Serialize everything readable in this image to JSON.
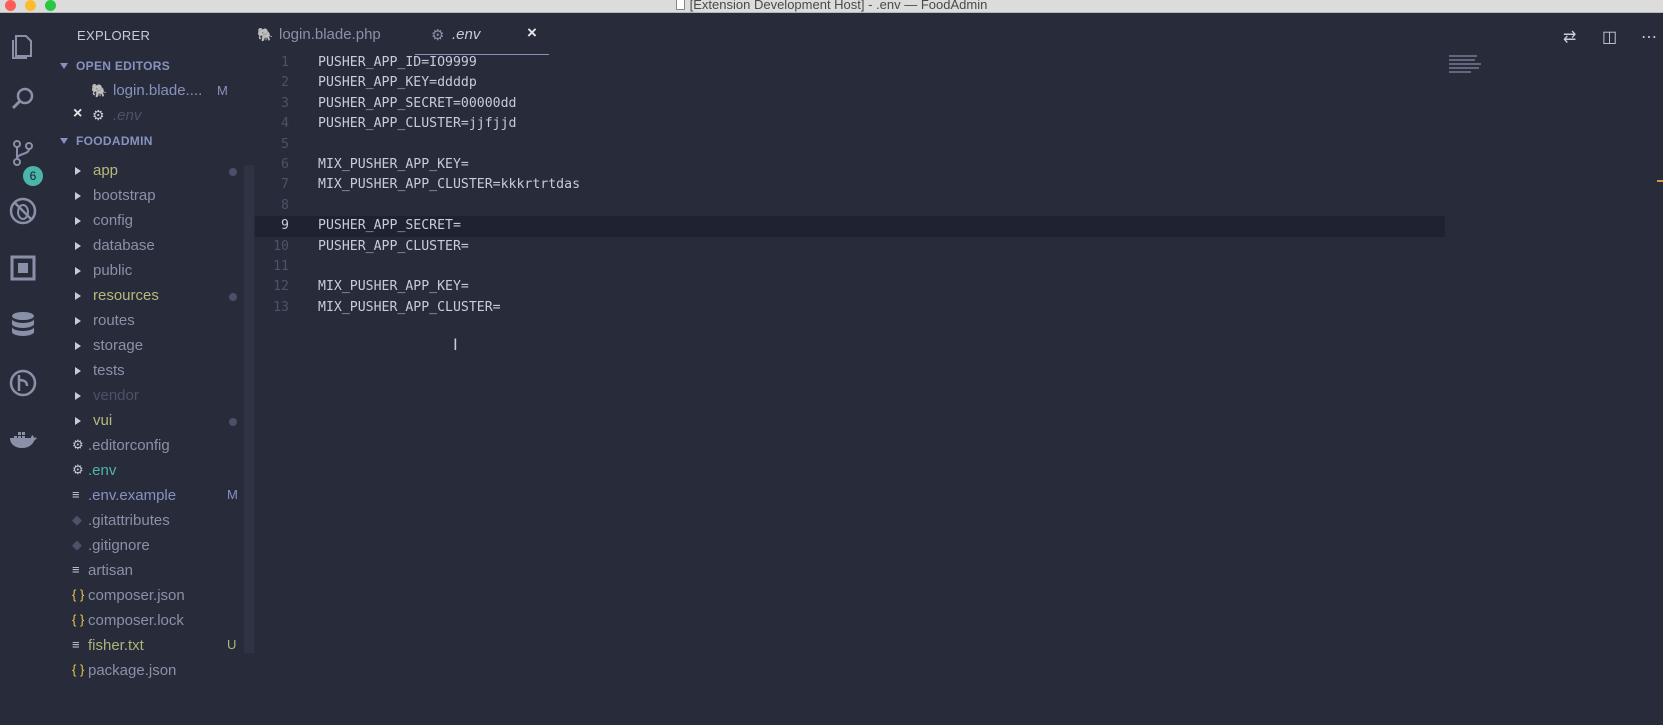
{
  "window": {
    "title": "[Extension Development Host] - .env — FoodAdmin"
  },
  "activity_bar": {
    "items": [
      "files-icon",
      "search-icon",
      "source-control-icon",
      "debug-icon",
      "extensions-icon",
      "database-icon",
      "git-graph-icon",
      "docker-icon"
    ],
    "source_control_badge": "6"
  },
  "sidebar": {
    "title": "EXPLORER",
    "open_editors_header": "OPEN EDITORS",
    "open_editors": [
      {
        "label": "login.blade....",
        "status": "M"
      },
      {
        "label": ".env"
      }
    ],
    "project_header": "FOODADMIN",
    "folders": [
      {
        "label": "app",
        "modified": true
      },
      {
        "label": "bootstrap",
        "modified": false
      },
      {
        "label": "config",
        "modified": false
      },
      {
        "label": "database",
        "modified": false
      },
      {
        "label": "public",
        "modified": false
      },
      {
        "label": "resources",
        "modified": true
      },
      {
        "label": "routes",
        "modified": false
      },
      {
        "label": "storage",
        "modified": false
      },
      {
        "label": "tests",
        "modified": false
      },
      {
        "label": "vendor",
        "modified": false
      },
      {
        "label": "vui",
        "modified": true
      }
    ],
    "files": [
      {
        "label": ".editorconfig",
        "icon": "gear-icon",
        "status": ""
      },
      {
        "label": ".env",
        "icon": "gear-icon",
        "status": ""
      },
      {
        "label": ".env.example",
        "icon": "lines-icon",
        "status": "M"
      },
      {
        "label": ".gitattributes",
        "icon": "git-icon",
        "status": ""
      },
      {
        "label": ".gitignore",
        "icon": "git-icon",
        "status": ""
      },
      {
        "label": "artisan",
        "icon": "lines-icon",
        "status": ""
      },
      {
        "label": "composer.json",
        "icon": "json-icon",
        "status": ""
      },
      {
        "label": "composer.lock",
        "icon": "json-icon",
        "status": ""
      },
      {
        "label": "fisher.txt",
        "icon": "lines-icon",
        "status": "U"
      },
      {
        "label": "package.json",
        "icon": "json-icon",
        "status": ""
      }
    ]
  },
  "tabs": [
    {
      "label": "login.blade.php",
      "active": false
    },
    {
      "label": ".env",
      "active": true
    }
  ],
  "editor": {
    "current_line": 9,
    "lines": [
      {
        "n": "1",
        "text": "PUSHER_APP_ID=IO9999"
      },
      {
        "n": "2",
        "text": "PUSHER_APP_KEY=ddddp"
      },
      {
        "n": "3",
        "text": "PUSHER_APP_SECRET=00000dd"
      },
      {
        "n": "4",
        "text": "PUSHER_APP_CLUSTER=jjfjjd"
      },
      {
        "n": "5",
        "text": ""
      },
      {
        "n": "6",
        "text": "MIX_PUSHER_APP_KEY="
      },
      {
        "n": "7",
        "text": "MIX_PUSHER_APP_CLUSTER=kkkrtrtdas"
      },
      {
        "n": "8",
        "text": ""
      },
      {
        "n": "9",
        "text": "PUSHER_APP_SECRET="
      },
      {
        "n": "10",
        "text": "PUSHER_APP_CLUSTER="
      },
      {
        "n": "11",
        "text": ""
      },
      {
        "n": "12",
        "text": "MIX_PUSHER_APP_KEY="
      },
      {
        "n": "13",
        "text": "MIX_PUSHER_APP_CLUSTER="
      }
    ]
  },
  "colors": {
    "background": "#282c3a",
    "folder_text": "#c8ccd8",
    "modified_text": "#b7b97a",
    "accent": "#8892c0",
    "untracked": "#7f8f5a"
  }
}
